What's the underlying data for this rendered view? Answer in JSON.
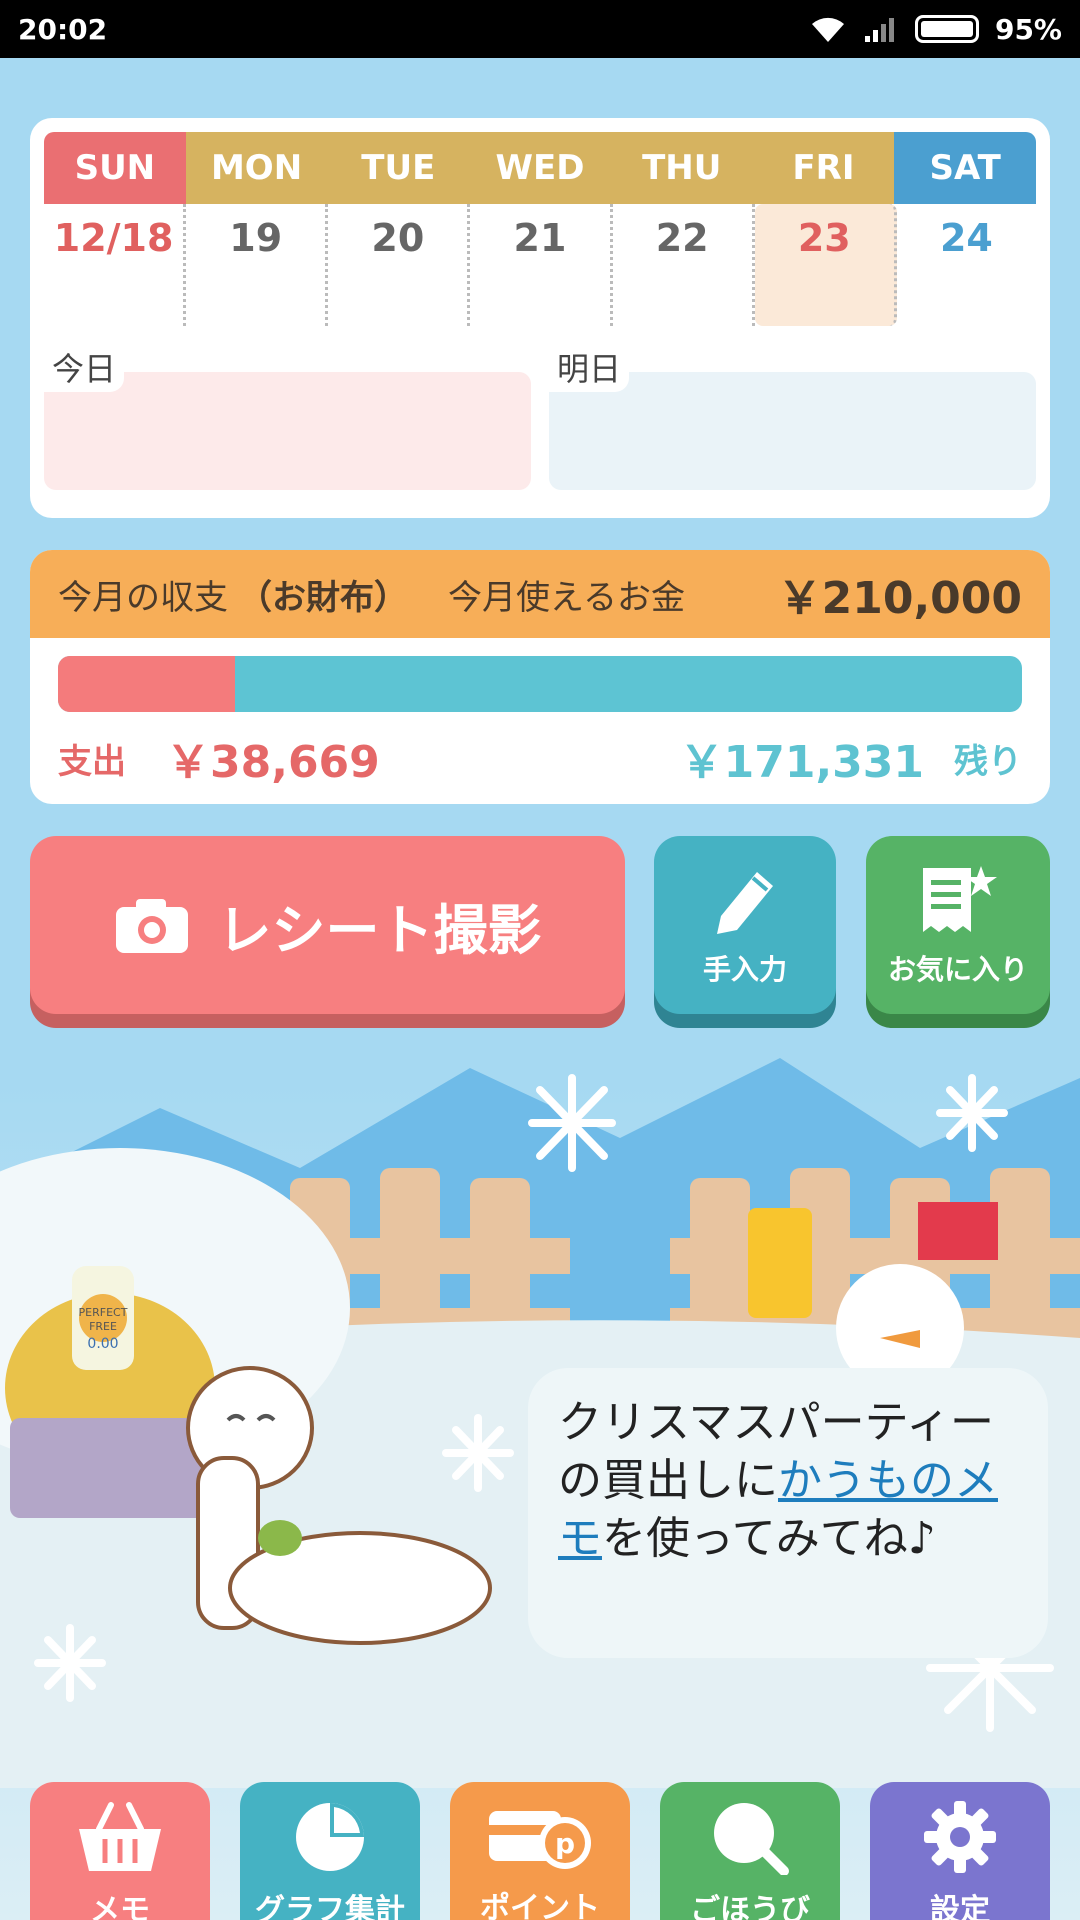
{
  "status_bar": {
    "time": "20:02",
    "battery_percent": "95%"
  },
  "calendar": {
    "days": [
      {
        "head": "SUN",
        "date": "12/18"
      },
      {
        "head": "MON",
        "date": "19"
      },
      {
        "head": "TUE",
        "date": "20"
      },
      {
        "head": "WED",
        "date": "21"
      },
      {
        "head": "THU",
        "date": "22"
      },
      {
        "head": "FRI",
        "date": "23"
      },
      {
        "head": "SAT",
        "date": "24"
      }
    ],
    "today_label": "今日",
    "tomorrow_label": "明日"
  },
  "budget": {
    "title": "今月の収支",
    "wallet": "（お財布）",
    "available_label": "今月使えるお金",
    "available_amount": "￥210,000",
    "spent_label": "支出",
    "spent_amount": "￥38,669",
    "remaining_amount": "￥171,331",
    "remaining_label": "残り",
    "spent_fraction": 0.184
  },
  "actions": {
    "receipt_label": "レシート撮影",
    "manual_label": "手入力",
    "favorite_label": "お気に入り"
  },
  "scene": {
    "can_text_1": "PERFECT",
    "can_text_2": "FREE",
    "can_text_3": "0.00"
  },
  "speech": {
    "text_before": "クリスマスパーティーの買出しに",
    "link_text": "かうものメモ",
    "text_after": "を使ってみてね♪"
  },
  "nav": {
    "memo": "メモ",
    "graph": "グラフ集計",
    "point": "ポイント",
    "reward": "ごほうび",
    "settings": "設定"
  },
  "colors": {
    "sunday": "#ea6f72",
    "saturday": "#4b9fd0",
    "weekday": "#d6b360",
    "budget_header": "#f7ae58",
    "spent": "#f47b7c",
    "remaining": "#5dc4d3"
  }
}
